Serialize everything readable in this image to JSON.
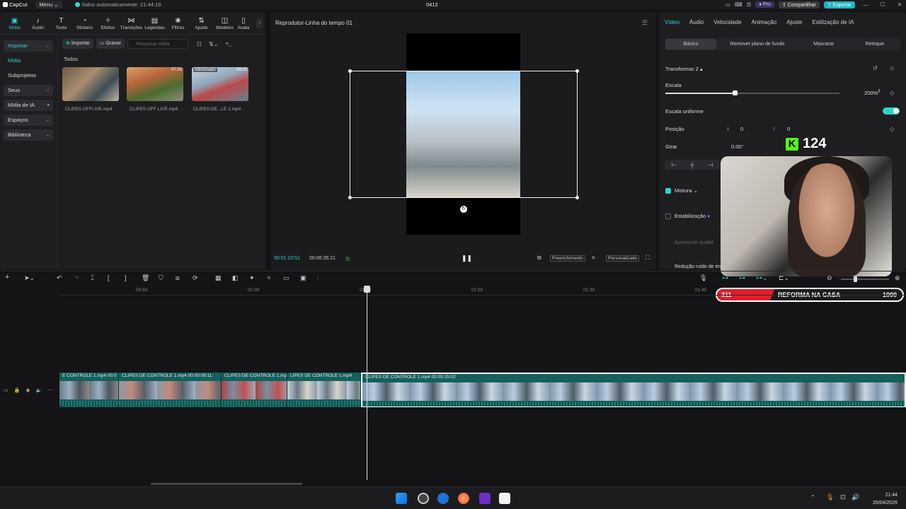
{
  "titlebar": {
    "app_name": "CapCut",
    "menu_label": "Menu",
    "autosave": "Salvo automaticamente: 21:44:19",
    "project_name": "0412",
    "pro_label": "Pro",
    "share_label": "Compartilhar",
    "export_label": "Exportar"
  },
  "toolbar": {
    "tabs": [
      "Mídia",
      "Áudio",
      "Texto",
      "Stickers",
      "Efeitos",
      "Transições",
      "Legendas",
      "Filtros",
      "Ajuste",
      "Modelos",
      "Avata"
    ]
  },
  "media": {
    "nav": [
      {
        "label": "Importar",
        "chev": "⌄"
      },
      {
        "label": "Mídia",
        "chev": ""
      },
      {
        "label": "Subprojetos",
        "chev": ""
      },
      {
        "label": "Seus",
        "chev": "⌄"
      },
      {
        "label": "Mídia de IA",
        "chev": ""
      },
      {
        "label": "Espaços",
        "chev": "⌄"
      },
      {
        "label": "Biblioteca",
        "chev": "⌄"
      }
    ],
    "import_label": "Importar",
    "record_label": "Gravar",
    "search_placeholder": "Pesquisar mídia",
    "section_label": "Todos",
    "items": [
      {
        "name": "CLIPES OFFLIVE.mp4",
        "tag": "",
        "duration": ""
      },
      {
        "name": "CLIPES OFF LIVE.mp4",
        "tag": "",
        "duration": "07:33"
      },
      {
        "name": "CLIPES DE...LE 1.mp4",
        "tag": "Adicionado",
        "duration": "09:10"
      }
    ]
  },
  "player": {
    "title": "Reprodutor-Linha do tempo 01",
    "current_time": "00:01:10:51",
    "total_time": "00:06:35:21",
    "fill_label": "Preenchimento",
    "custom_label": "Personalizado"
  },
  "props": {
    "tabs": [
      "Vídeo",
      "Áudio",
      "Velocidade",
      "Animação",
      "Ajuste",
      "Estilização de IA"
    ],
    "subtabs": [
      "Básico",
      "Remover plano de fundo",
      "Mascarar",
      "Retoque"
    ],
    "transform_label": "Transformar 2",
    "scale_label": "Escala",
    "scale_value": "200%",
    "scale_fraction": 0.4,
    "uniform_label": "Escala uniforme",
    "position_label": "Posição",
    "pos_x_label": "X",
    "pos_x": "0",
    "pos_y_label": "Y",
    "pos_y": "0",
    "rotate_label": "Girar",
    "rotate_value": "0.00°",
    "blend_label": "Mistura",
    "stabilize_label": "Estabilização",
    "quality_label": "Aprimorar qualid",
    "noise_label": "Redução ruído de im"
  },
  "overlay": {
    "kick_count": "124",
    "goal_current": "311",
    "goal_title": "REFORMA NA CASA",
    "goal_target": "1000"
  },
  "timeline": {
    "ticks": [
      "00:50",
      "01:00",
      "01:10",
      "01:20",
      "01:30",
      "01:40"
    ],
    "clips": [
      {
        "label": "E CONTROLE 1.mp4  00:0"
      },
      {
        "label": "CLIPES DE CONTROLE 1.mp4  00:00:09:11"
      },
      {
        "label": "CLIPES DE CONTROLE 1.mp"
      },
      {
        "label": "LIPES DE CONTROLE 1.mp4"
      },
      {
        "label": "CLIPES DE CONTROLE 1.mp4  00:05:25:02"
      }
    ]
  },
  "taskbar": {
    "time": "21:44",
    "date": "26/04/2026"
  }
}
